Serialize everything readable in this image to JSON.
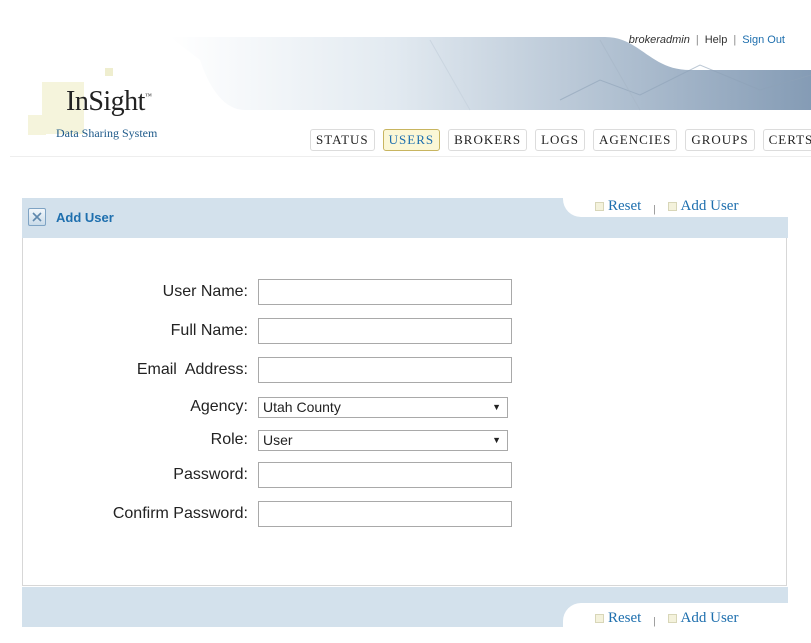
{
  "header": {
    "username": "brokeradmin",
    "help": "Help",
    "sign_out": "Sign Out",
    "logo_title": "InSight",
    "logo_tm": "™",
    "logo_subtitle": "Data Sharing System"
  },
  "nav": {
    "tabs": [
      {
        "label": "STATUS",
        "active": false
      },
      {
        "label": "USERS",
        "active": true
      },
      {
        "label": "BROKERS",
        "active": false
      },
      {
        "label": "LOGS",
        "active": false
      },
      {
        "label": "AGENCIES",
        "active": false
      },
      {
        "label": "GROUPS",
        "active": false
      },
      {
        "label": "CERTS",
        "active": false
      }
    ]
  },
  "panel": {
    "title": "Add User",
    "actions": {
      "reset": "Reset",
      "separator": "|",
      "add_user": "Add User"
    }
  },
  "form": {
    "user_name_label": "User Name:",
    "full_name_label": "Full Name:",
    "email_label": "Email  Address:",
    "agency_label": "Agency:",
    "agency_value": "Utah County",
    "role_label": "Role:",
    "role_value": "User",
    "password_label": "Password:",
    "confirm_password_label": "Confirm Password:",
    "select_arrow": "▼"
  },
  "colors": {
    "accent": "#1e6fae",
    "panel_bar": "#d3e1ec",
    "active_tab_bg": "#fbf7d6"
  }
}
